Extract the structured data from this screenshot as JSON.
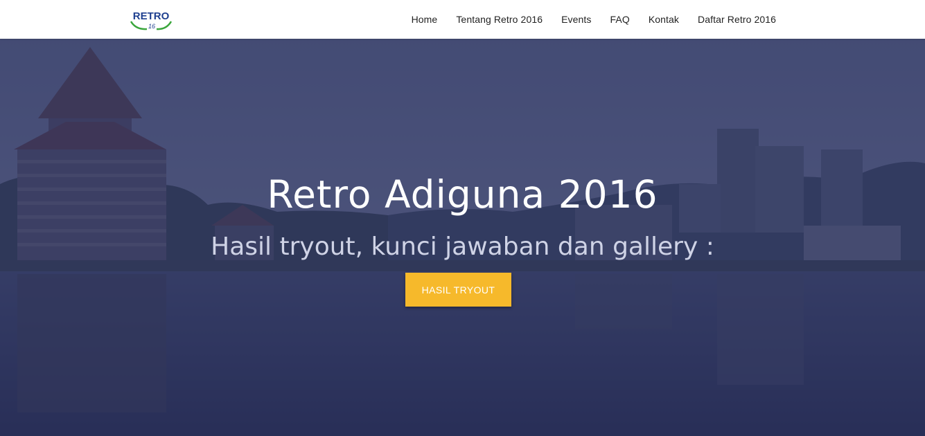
{
  "brand": {
    "logo_text": "RETRO",
    "logo_sub": "16"
  },
  "nav": {
    "items": [
      {
        "label": "Home"
      },
      {
        "label": "Tentang Retro 2016"
      },
      {
        "label": "Events"
      },
      {
        "label": "FAQ"
      },
      {
        "label": "Kontak"
      },
      {
        "label": "Daftar Retro 2016"
      }
    ]
  },
  "hero": {
    "title": "Retro Adiguna 2016",
    "subtitle": "Hasil tryout, kunci jawaban dan gallery :",
    "button_label": "HASIL TRYOUT"
  },
  "colors": {
    "overlay": "#2b3358",
    "button": "#f6b92b",
    "logo_blue": "#1e3f8f",
    "logo_green": "#3aa63c"
  }
}
